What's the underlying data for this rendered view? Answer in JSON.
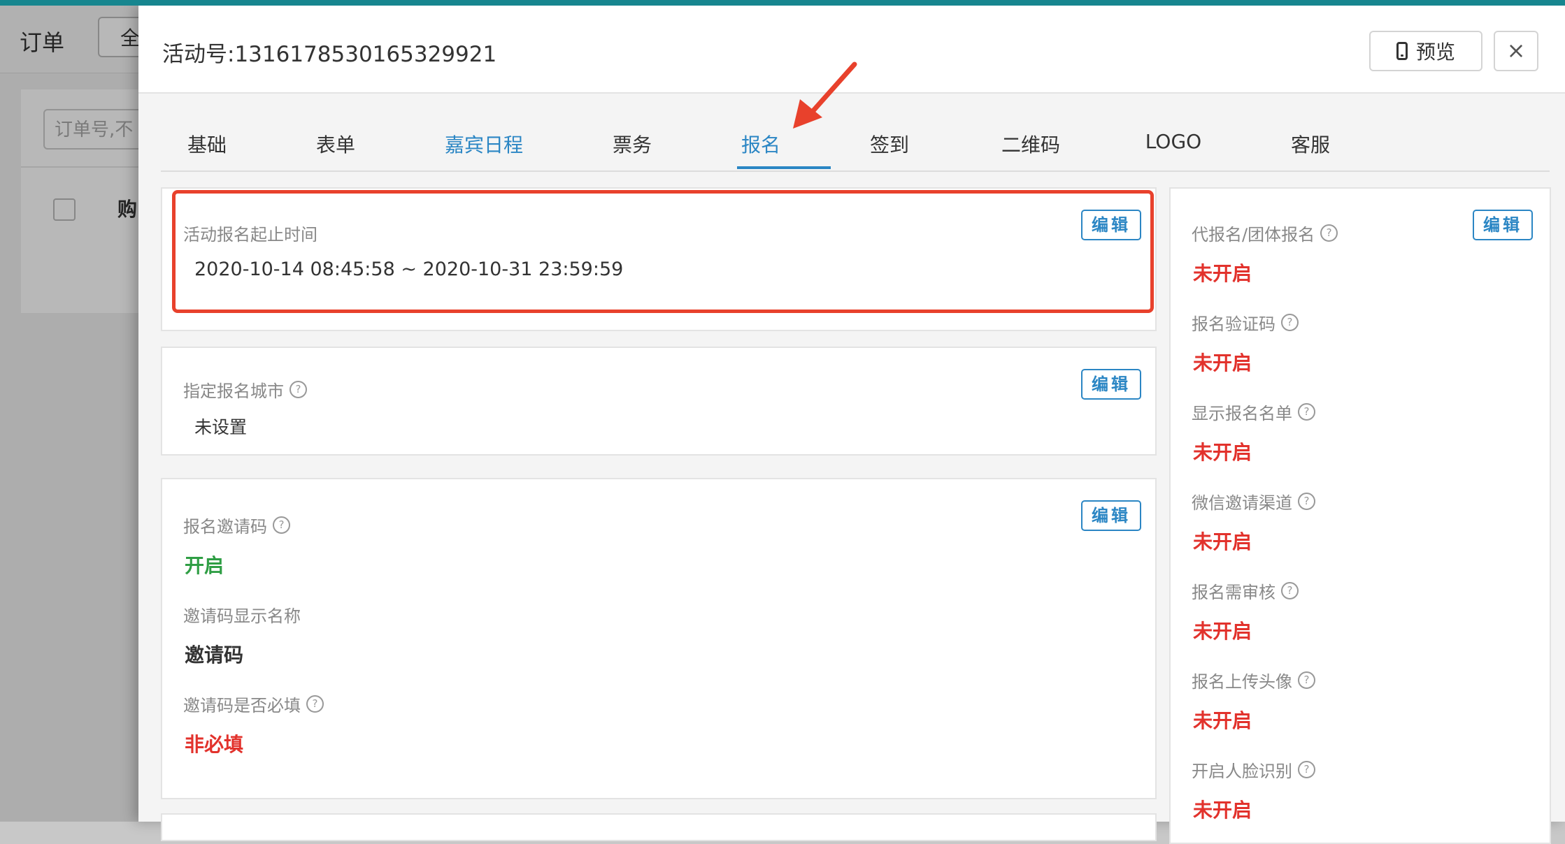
{
  "background": {
    "title": "订单",
    "button_label": "全",
    "search_placeholder": "订单号,不",
    "column_label": "购"
  },
  "drawer": {
    "title": "活动号:1316178530165329921",
    "preview_label": "预览",
    "close_label": "×"
  },
  "tabs": [
    {
      "label": "基础"
    },
    {
      "label": "表单"
    },
    {
      "label": "嘉宾日程"
    },
    {
      "label": "票务"
    },
    {
      "label": "报名"
    },
    {
      "label": "签到"
    },
    {
      "label": "二维码"
    },
    {
      "label": "LOGO"
    },
    {
      "label": "客服"
    }
  ],
  "active_tab": "报名",
  "edit_label": "编辑",
  "help_glyph": "?",
  "time_card": {
    "label": "活动报名起止时间",
    "value": "2020-10-14 08:45:58 ~ 2020-10-31 23:59:59"
  },
  "city_card": {
    "label": "指定报名城市",
    "value": "未设置"
  },
  "invite_card": {
    "code_label": "报名邀请码",
    "code_status": "开启",
    "name_label": "邀请码显示名称",
    "name_value": "邀请码",
    "required_label": "邀请码是否必填",
    "required_value": "非必填"
  },
  "right_panel": {
    "items": [
      {
        "label": "代报名/团体报名",
        "status": "未开启"
      },
      {
        "label": "报名验证码",
        "status": "未开启"
      },
      {
        "label": "显示报名名单",
        "status": "未开启"
      },
      {
        "label": "微信邀请渠道",
        "status": "未开启"
      },
      {
        "label": "报名需审核",
        "status": "未开启"
      },
      {
        "label": "报名上传头像",
        "status": "未开启"
      },
      {
        "label": "开启人脸识别",
        "status": "未开启"
      }
    ]
  },
  "colors": {
    "accent": "#2b86c4",
    "off": "#e2322c",
    "on": "#2f9e44",
    "annotation": "#e8412c",
    "topbar": "#17868f"
  }
}
